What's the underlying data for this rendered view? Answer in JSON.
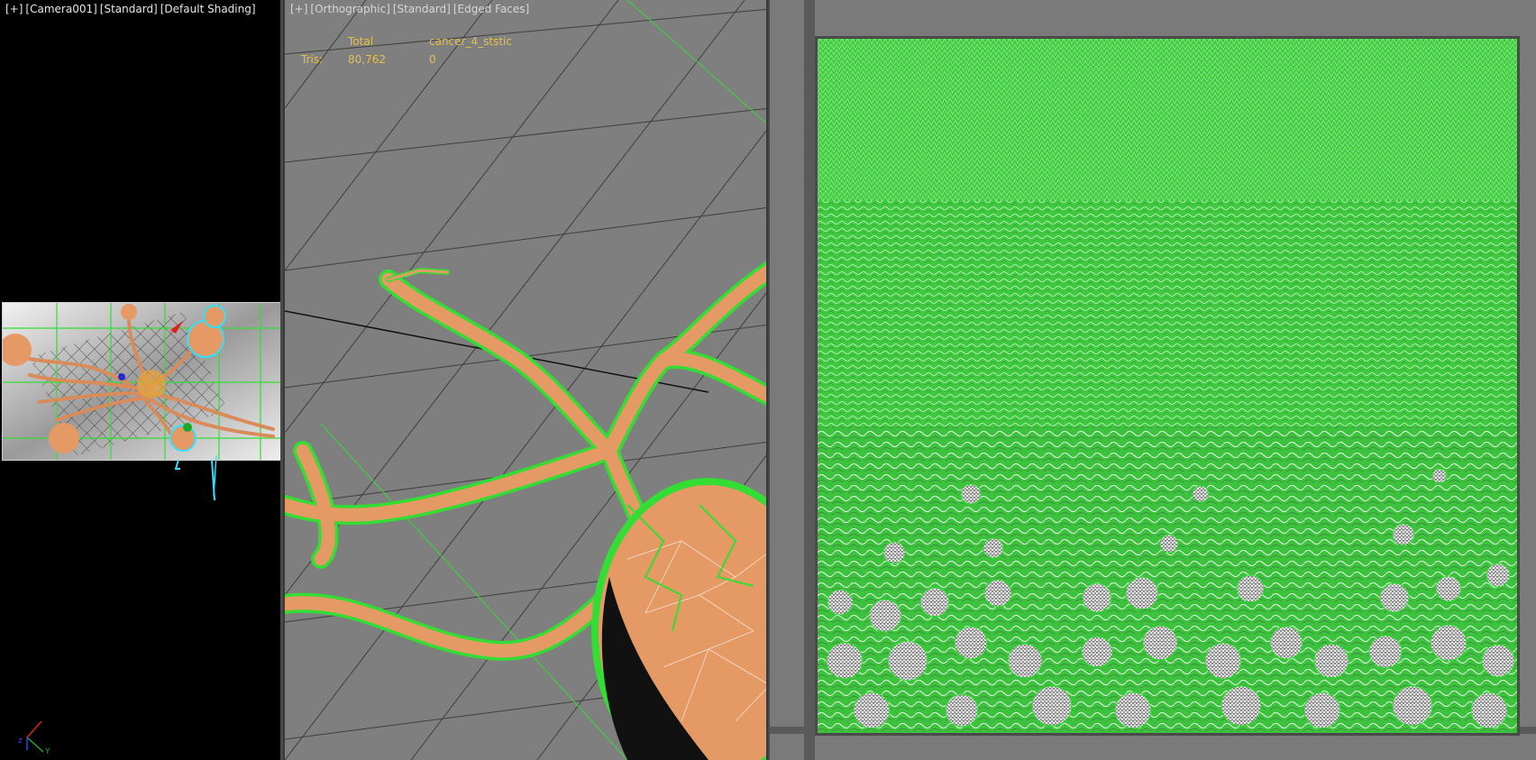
{
  "viewports": {
    "camera": {
      "labels": [
        "[+]",
        "[Camera001]",
        "[Standard]",
        "[Default Shading]"
      ],
      "gizmo": {
        "x_label": "x",
        "y_label": "Y",
        "z_label": "z"
      }
    },
    "orthographic": {
      "labels": [
        "[+]",
        "[Orthographic]",
        "[Standard]",
        "[Edged Faces]"
      ],
      "stats": {
        "header_total": "Total",
        "header_object": "cancer_4_ststic",
        "row_label": "Tris:",
        "row_total": "80,762",
        "row_object": "0"
      }
    }
  },
  "colors": {
    "wireframe": "#33dd33",
    "mesh": "#e59a66",
    "viewport_bg": "#7f7f7f",
    "selection": "#33e0ff",
    "stats_text": "#e3c24a"
  }
}
